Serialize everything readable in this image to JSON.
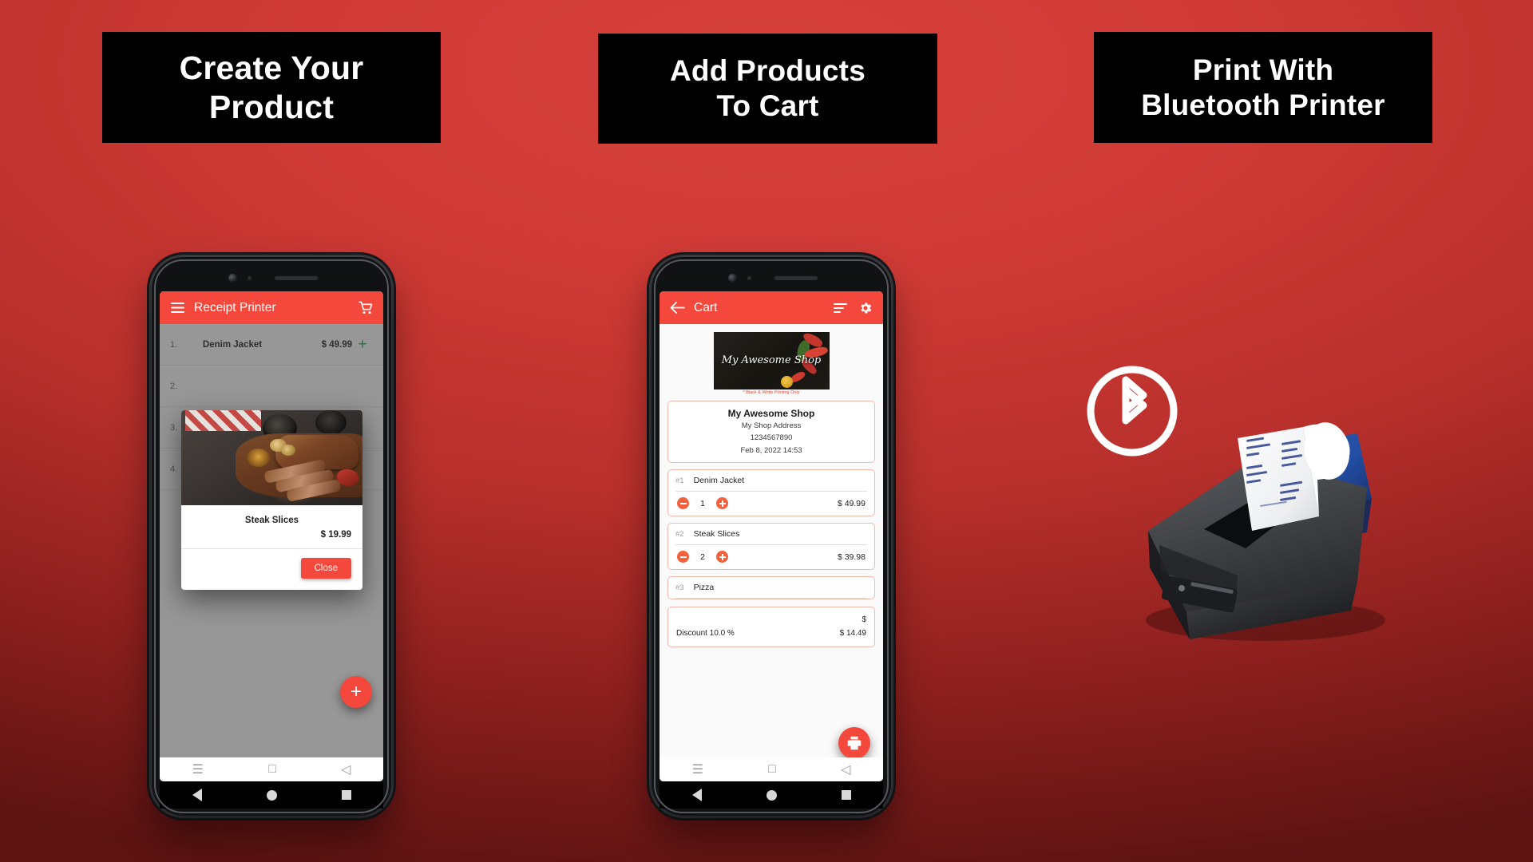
{
  "banners": [
    {
      "id": "create-product",
      "line1": "Create Your",
      "line2": "Product"
    },
    {
      "id": "add-to-cart",
      "line1": "Add Products",
      "line2": "To Cart"
    },
    {
      "id": "bluetooth-print",
      "line1": "Print With",
      "line2": "Bluetooth Printer"
    }
  ],
  "colors": {
    "background_red": "#cf3a35",
    "banner_bg": "#000000",
    "accent": "#f4483c",
    "quantity_button": "#f4603b",
    "card_border": "#f0b9ac",
    "add_plus_green": "#2e9e4f"
  },
  "phone1": {
    "appbar": {
      "title": "Receipt Printer",
      "menu_icon": "hamburger-menu-icon",
      "cart_icon": "shopping-cart-icon"
    },
    "list": [
      {
        "index": "1.",
        "name": "Denim Jacket",
        "price": "$ 49.99",
        "add": "+"
      },
      {
        "index": "2.",
        "name": "",
        "price": "",
        "add": ""
      },
      {
        "index": "3.",
        "name": "",
        "price": "",
        "add": ""
      },
      {
        "index": "4.",
        "name": "",
        "price": "",
        "add": ""
      }
    ],
    "dialog": {
      "image": "steak-slices-photo",
      "product_name": "Steak Slices",
      "price": "$ 19.99",
      "close_label": "Close"
    },
    "fab": {
      "icon": "plus-icon",
      "label": "+"
    },
    "navbar": {
      "menu": "menu-icon",
      "home": "square-icon",
      "back": "triangle-back-icon"
    }
  },
  "phone2": {
    "appbar": {
      "back_icon": "arrow-back-icon",
      "title": "Cart",
      "list_icon": "list-lines-icon",
      "settings_icon": "gear-icon"
    },
    "shop_banner": {
      "name_line1": "My Awesome",
      "name_line2": "Shop",
      "note": "* Black & White Printing Only"
    },
    "shop_info": {
      "name": "My Awesome Shop",
      "address": "My Shop Address",
      "phone": "1234567890",
      "datetime": "Feb 8, 2022 14:53"
    },
    "items": [
      {
        "hash": "#1",
        "name": "Denim Jacket",
        "minus": "minus-icon",
        "qty": "1",
        "plus": "plus-icon",
        "price": "$ 49.99"
      },
      {
        "hash": "#2",
        "name": "Steak Slices",
        "minus": "minus-icon",
        "qty": "2",
        "plus": "plus-icon",
        "price": "$ 39.98"
      },
      {
        "hash": "#3",
        "name": "Pizza",
        "minus": "minus-icon",
        "qty": "",
        "plus": "plus-icon",
        "price": ""
      }
    ],
    "totals": [
      {
        "label": "",
        "value": "$"
      },
      {
        "label": "Discount 10.0 %",
        "value": "$ 14.49"
      }
    ],
    "fab": {
      "icon": "printer-icon"
    }
  },
  "panel3": {
    "bluetooth_icon": "bluetooth-icon",
    "printer_image": "bluetooth-thermal-printer-photo"
  }
}
